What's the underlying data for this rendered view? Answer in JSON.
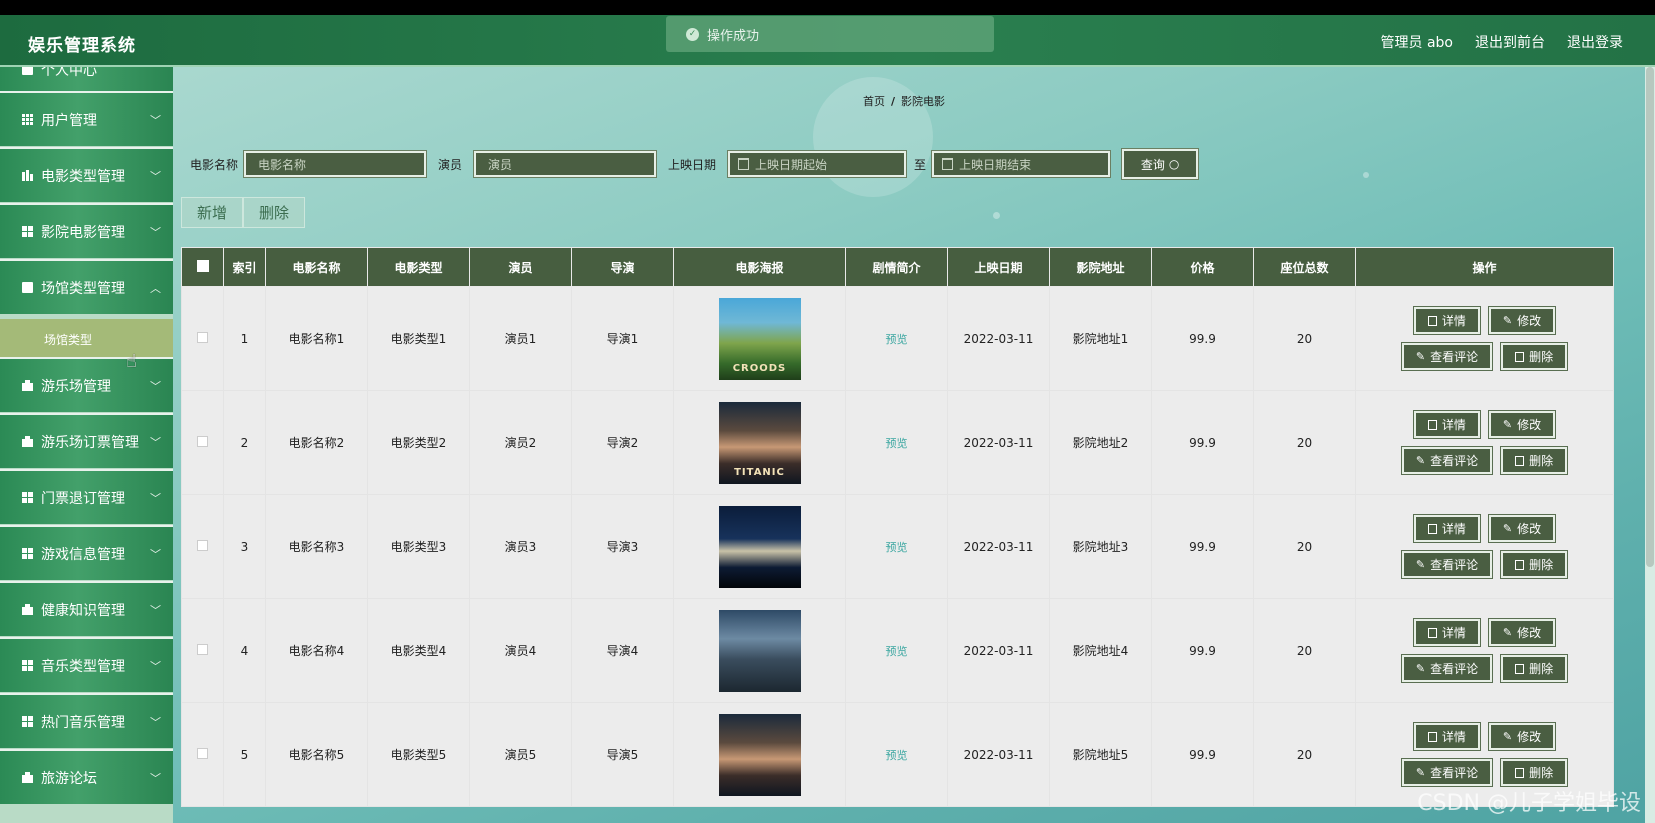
{
  "app": {
    "title": "娱乐管理系统"
  },
  "header": {
    "admin": "管理员 abo",
    "frontend": "退出到前台",
    "logout": "退出登录"
  },
  "toast": {
    "message": "操作成功"
  },
  "sidebar": {
    "items": [
      {
        "label": "个人中心",
        "icon": "user-icon"
      },
      {
        "label": "用户管理",
        "icon": "grid-icon"
      },
      {
        "label": "电影类型管理",
        "icon": "bar-chart-icon"
      },
      {
        "label": "影院电影管理",
        "icon": "grid-icon"
      },
      {
        "label": "场馆类型管理",
        "icon": "document-icon"
      },
      {
        "label": "游乐场管理",
        "icon": "briefcase-icon"
      },
      {
        "label": "游乐场订票管理",
        "icon": "briefcase-icon"
      },
      {
        "label": "门票退订管理",
        "icon": "grid-icon"
      },
      {
        "label": "游戏信息管理",
        "icon": "grid-icon"
      },
      {
        "label": "健康知识管理",
        "icon": "briefcase-icon"
      },
      {
        "label": "音乐类型管理",
        "icon": "grid-icon"
      },
      {
        "label": "热门音乐管理",
        "icon": "grid-icon"
      },
      {
        "label": "旅游论坛",
        "icon": "briefcase-icon"
      }
    ],
    "submenu": {
      "label": "场馆类型"
    }
  },
  "breadcrumb": {
    "home": "首页",
    "sep": "/",
    "current": "影院电影"
  },
  "search": {
    "name_label": "电影名称",
    "name_placeholder": "电影名称",
    "actor_label": "演员",
    "actor_placeholder": "演员",
    "date_label": "上映日期",
    "date_start_placeholder": "上映日期起始",
    "to_label": "至",
    "date_end_placeholder": "上映日期结束",
    "query_label": "查询"
  },
  "toolbar": {
    "add_label": "新增",
    "delete_label": "删除"
  },
  "table": {
    "headers": [
      "索引",
      "电影名称",
      "电影类型",
      "演员",
      "导演",
      "电影海报",
      "剧情简介",
      "上映日期",
      "影院地址",
      "价格",
      "座位总数",
      "操作"
    ],
    "rows": [
      {
        "index": "1",
        "name": "电影名称1",
        "type": "电影类型1",
        "actor": "演员1",
        "director": "导演1",
        "poster": "CROODS",
        "synopsis": "预览",
        "date": "2022-03-11",
        "address": "影院地址1",
        "price": "99.9",
        "seats": "20"
      },
      {
        "index": "2",
        "name": "电影名称2",
        "type": "电影类型2",
        "actor": "演员2",
        "director": "导演2",
        "poster": "TITANIC",
        "synopsis": "预览",
        "date": "2022-03-11",
        "address": "影院地址2",
        "price": "99.9",
        "seats": "20"
      },
      {
        "index": "3",
        "name": "电影名称3",
        "type": "电影类型3",
        "actor": "演员3",
        "director": "导演3",
        "poster": "",
        "synopsis": "预览",
        "date": "2022-03-11",
        "address": "影院地址3",
        "price": "99.9",
        "seats": "20"
      },
      {
        "index": "4",
        "name": "电影名称4",
        "type": "电影类型4",
        "actor": "演员4",
        "director": "导演4",
        "poster": "",
        "synopsis": "预览",
        "date": "2022-03-11",
        "address": "影院地址4",
        "price": "99.9",
        "seats": "20"
      },
      {
        "index": "5",
        "name": "电影名称5",
        "type": "电影类型5",
        "actor": "演员5",
        "director": "导演5",
        "poster": "",
        "synopsis": "预览",
        "date": "2022-03-11",
        "address": "影院地址5",
        "price": "99.9",
        "seats": "20"
      }
    ],
    "ops": {
      "detail": "详情",
      "edit": "修改",
      "comments": "查看评论",
      "delete": "删除"
    }
  },
  "watermark": "CSDN @儿子学姐毕设"
}
